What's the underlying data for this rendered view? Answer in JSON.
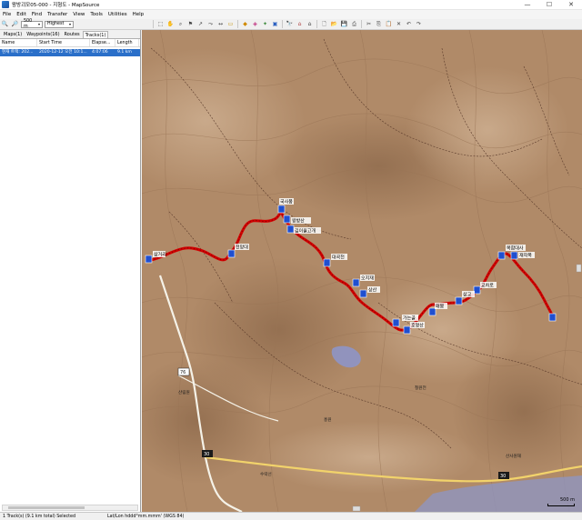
{
  "window": {
    "title": "왕방괴모05-000 - 지형도 - MapSource",
    "min": "—",
    "max": "☐",
    "close": "✕"
  },
  "menu": [
    "File",
    "Edit",
    "Find",
    "Transfer",
    "View",
    "Tools",
    "Utilities",
    "Help"
  ],
  "toolbar": {
    "zoom_value": "500 m",
    "detail_value": "Highest"
  },
  "tabs": [
    {
      "label": "Maps(1)"
    },
    {
      "label": "Waypoints(16)"
    },
    {
      "label": "Routes"
    },
    {
      "label": "Tracks(1)"
    }
  ],
  "track_table": {
    "headers": [
      "Name",
      "Start Time",
      "Elapse...",
      "Length"
    ],
    "rows": [
      {
        "name": "현재 트랙: 202...",
        "start": "2020-12-12 오전 10:1...",
        "elapsed": "4:07:06",
        "length": "9.1 km"
      }
    ]
  },
  "map": {
    "scale_label": "500 m",
    "route_labels": [
      "삼거리",
      "전망대",
      "국사봉",
      "왕방산",
      "깊이울고개",
      "대곡천",
      "오지재",
      "상산",
      "가는골",
      "호명산",
      "매봉",
      "삼교",
      "교차로",
      "복합대사",
      "재작목"
    ],
    "road_badges": [
      "30",
      "30",
      "76"
    ],
    "map_text": [
      "산림원",
      "수락선",
      "철원전",
      "홍원",
      "산사원재"
    ],
    "colors": {
      "terrain": "#b08a68",
      "track": "#d40000",
      "waypoint": "#1f4fd0"
    }
  },
  "status": {
    "left": "1 Track(s) (9.1 km total) Selected",
    "right": "Lat/Lon hddd°mm.mmm' (WGS 84)"
  }
}
